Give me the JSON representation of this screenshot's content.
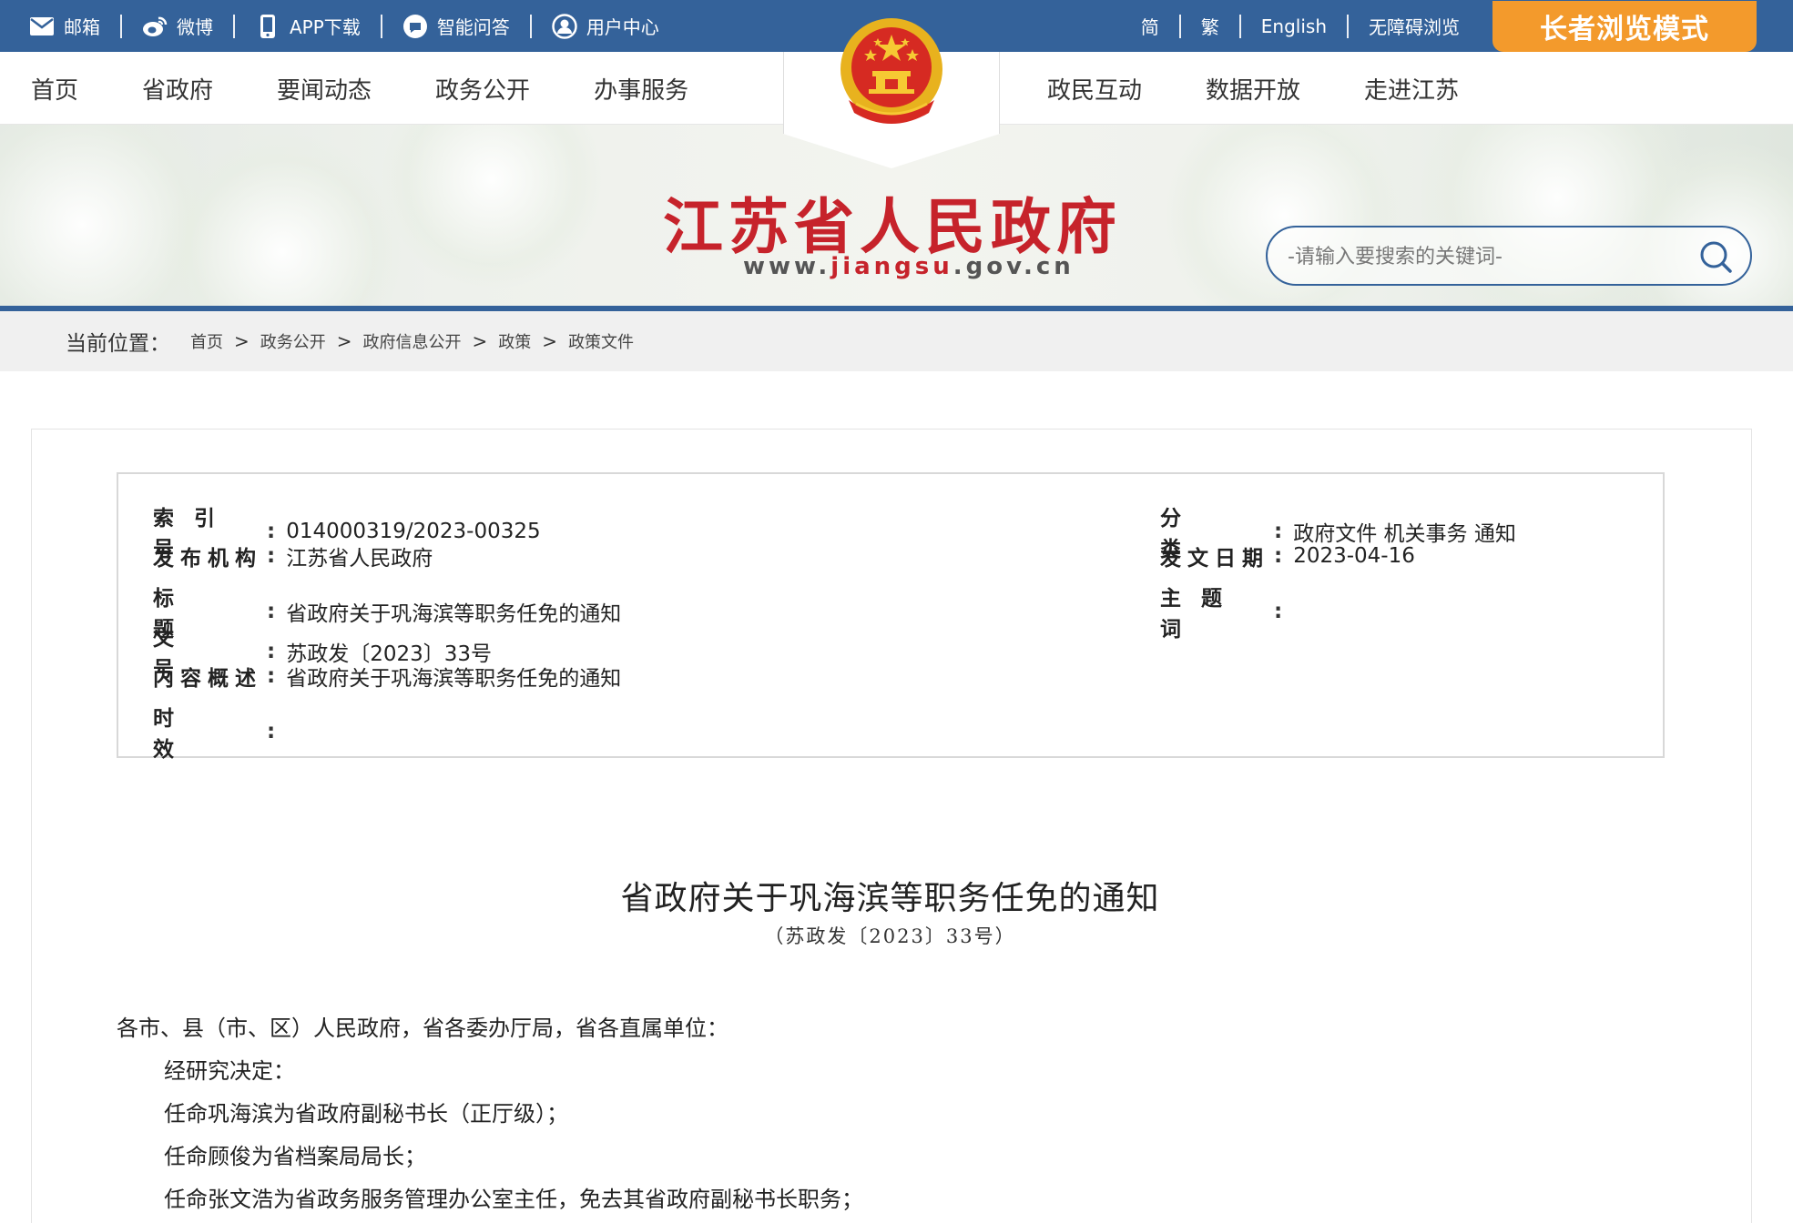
{
  "topbar": {
    "links": [
      {
        "label": "邮箱",
        "icon": "mail-icon"
      },
      {
        "label": "微博",
        "icon": "weibo-icon"
      },
      {
        "label": "APP下载",
        "icon": "phone-icon"
      },
      {
        "label": "智能问答",
        "icon": "chat-icon"
      },
      {
        "label": "用户中心",
        "icon": "user-icon"
      }
    ],
    "lang": [
      "简",
      "繁",
      "English",
      "无障碍浏览"
    ],
    "elder_mode": "长者浏览模式"
  },
  "nav": {
    "left": [
      "首页",
      "省政府",
      "要闻动态",
      "政务公开",
      "办事服务"
    ],
    "right": [
      "政民互动",
      "数据开放",
      "走进江苏"
    ]
  },
  "banner": {
    "title": "江苏省人民政府",
    "url_prefix": "www.",
    "url_highlight": "jiangsu",
    "url_suffix": ".gov.cn",
    "search_placeholder": "-请输入要搜索的关键词-"
  },
  "breadcrumb": {
    "label": "当前位置：",
    "items": [
      "首页",
      "政务公开",
      "政府信息公开",
      "政策",
      "政策文件"
    ],
    "separator": ">"
  },
  "meta": {
    "index_no_key": "索引号",
    "index_no": "014000319/2023-00325",
    "category_key": "分类",
    "category": "政府文件 机关事务 通知",
    "issuer_key": "发布机构",
    "issuer": "江苏省人民政府",
    "date_key": "发文日期",
    "date": "2023-04-16",
    "title_key": "标题",
    "title": "省政府关于巩海滨等职务任免的通知",
    "subject_key": "主题词",
    "subject": "",
    "doc_no_key": "文号",
    "doc_no": "苏政发〔2023〕33号",
    "summary_key": "内容概述",
    "summary": "省政府关于巩海滨等职务任免的通知",
    "validity_key": "时效",
    "validity": ""
  },
  "document": {
    "title": "省政府关于巩海滨等职务任免的通知",
    "number": "（苏政发〔2023〕33号）",
    "lines": [
      "各市、县（市、区）人民政府，省各委办厅局，省各直属单位：",
      "经研究决定：",
      "任命巩海滨为省政府副秘书长（正厅级）；",
      "任命顾俊为省档案局局长；",
      "任命张文浩为省政务服务管理办公室主任，免去其省政府副秘书长职务；"
    ]
  },
  "colors": {
    "topbar": "#34629a",
    "elder_button": "#f39a2c",
    "title_red": "#c6232b"
  }
}
